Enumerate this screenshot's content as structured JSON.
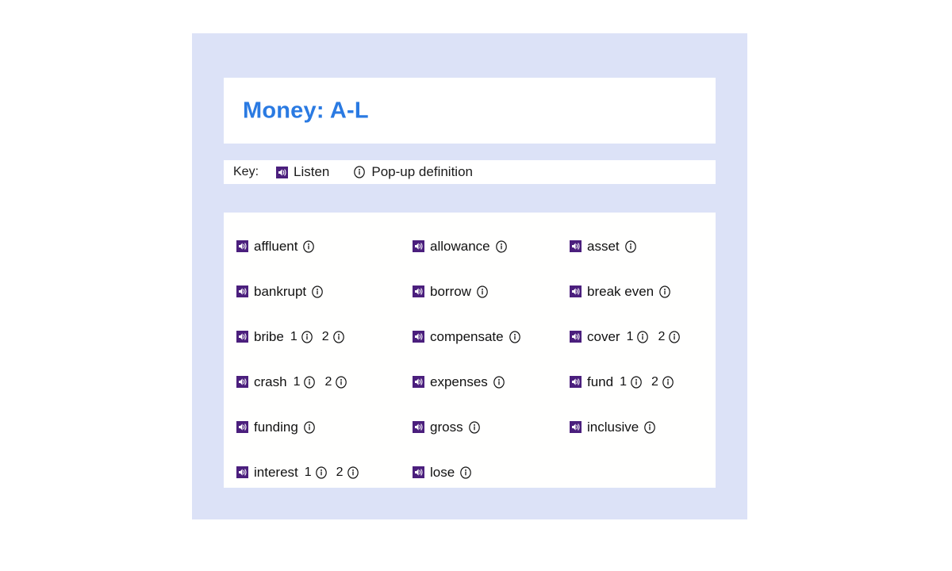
{
  "page": {
    "title": "Money: A-L",
    "accent_color": "#2a7ae2",
    "panel_color": "#dce2f7",
    "speaker_icon_color": "#4b1f7d",
    "card_color": "#ffffff"
  },
  "key": {
    "label": "Key:",
    "items": [
      {
        "icon": "speaker-icon",
        "text": "Listen"
      },
      {
        "icon": "info-icon",
        "text": "Pop-up definition"
      }
    ]
  },
  "words": {
    "columns": [
      [
        {
          "word": "affluent",
          "senses": [
            ""
          ]
        },
        {
          "word": "bankrupt",
          "senses": [
            ""
          ]
        },
        {
          "word": "bribe",
          "senses": [
            "1",
            "2"
          ]
        },
        {
          "word": "crash",
          "senses": [
            "1",
            "2"
          ]
        },
        {
          "word": "funding",
          "senses": [
            ""
          ]
        },
        {
          "word": "interest",
          "senses": [
            "1",
            "2"
          ]
        }
      ],
      [
        {
          "word": "allowance",
          "senses": [
            ""
          ]
        },
        {
          "word": "borrow",
          "senses": [
            ""
          ]
        },
        {
          "word": "compensate",
          "senses": [
            ""
          ]
        },
        {
          "word": "expenses",
          "senses": [
            ""
          ]
        },
        {
          "word": "gross",
          "senses": [
            ""
          ]
        },
        {
          "word": "lose",
          "senses": [
            ""
          ]
        }
      ],
      [
        {
          "word": "asset",
          "senses": [
            ""
          ]
        },
        {
          "word": "break even",
          "senses": [
            ""
          ]
        },
        {
          "word": "cover",
          "senses": [
            "1",
            "2"
          ]
        },
        {
          "word": "fund",
          "senses": [
            "1",
            "2"
          ]
        },
        {
          "word": "inclusive",
          "senses": [
            ""
          ]
        }
      ]
    ]
  }
}
